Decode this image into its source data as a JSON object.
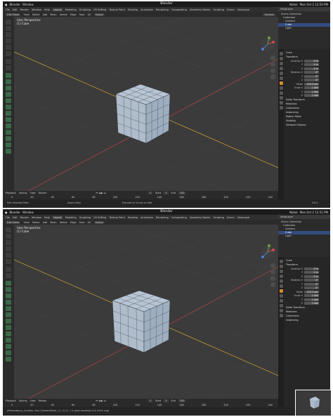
{
  "menubar": {
    "app": "Blender",
    "window_menu": "Window",
    "title": "Blender",
    "status_top": {
      "user": "Nahal",
      "datetime": "Mon Oct 2  12:50 PM"
    },
    "status_bottom": {
      "user": "Nahal",
      "datetime": "Mon Oct 2  12:51 PM"
    }
  },
  "topbar": {
    "items": [
      "File",
      "Edit",
      "Render",
      "Window",
      "Help",
      "Layout",
      "Modeling",
      "Sculpting",
      "UV Editing",
      "Texture Paint",
      "Shading",
      "Animation",
      "Rendering",
      "Compositing",
      "Geometry Nodes",
      "Scripting"
    ],
    "active": "Layout",
    "scene": "Scene",
    "view_layer": "ViewLayer"
  },
  "header": {
    "mode": "Edit Mode",
    "menus": [
      "View",
      "Select",
      "Add",
      "Mesh",
      "Vertex",
      "Edge",
      "Face",
      "UV"
    ],
    "orientation": "Global",
    "options": "Options"
  },
  "viewport": {
    "perspective": "User Perspective",
    "object_label": "(1) Cube"
  },
  "outliner": {
    "items": [
      {
        "label": "Scene Collection",
        "selected": false
      },
      {
        "label": "Collection",
        "selected": false
      },
      {
        "label": "Camera",
        "selected": false
      },
      {
        "label": "Cube",
        "selected": true
      },
      {
        "label": "Light",
        "selected": false
      }
    ]
  },
  "properties": {
    "object_name": "Cube",
    "transform_header": "Transform",
    "location_label": "Location X",
    "y_label": "Y",
    "z_label": "Z",
    "rotation_label": "Rotation X",
    "mode_label": "Mode",
    "mode_value": "XYZ Euler",
    "scale_label": "Scale X",
    "loc": [
      "0 m",
      "0 m",
      "0 m"
    ],
    "rot": [
      "0°",
      "0°",
      "0°"
    ],
    "scale": [
      "1.000",
      "1.000",
      "1.000"
    ],
    "sections": [
      "Delta Transform",
      "Relations",
      "Collections",
      "Instancing",
      "Motion Paths",
      "Visibility",
      "Viewport Display"
    ]
  },
  "timeline": {
    "menus": [
      "Playback",
      "Keying",
      "View",
      "Marker"
    ],
    "frame": "1",
    "start_label": "Start",
    "start": "1",
    "end_label": "End",
    "end": "250",
    "ticks": [
      "0",
      "20",
      "40",
      "60",
      "80",
      "100",
      "120",
      "140",
      "160",
      "180",
      "200",
      "220",
      "240"
    ]
  },
  "statusbar": {
    "top": [
      "Pick Shortest Path",
      "Zoom View",
      "Extrude to Cursor or Add"
    ],
    "bottom_log": "(Redundancy_Confirm, Dull_ForwardTwist, (-1,-1)-1) ,+1 (pick shortest) 0.4 (Click Log)",
    "version": "3.6.2"
  }
}
